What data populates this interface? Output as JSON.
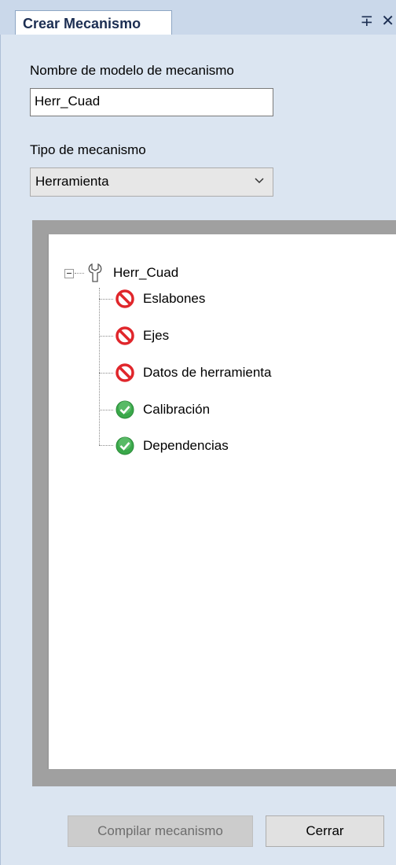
{
  "panel": {
    "tab_title": "Crear Mecanismo",
    "pin_glyph": "∓",
    "close_glyph": "✕"
  },
  "form": {
    "model_name_label": "Nombre de modelo de mecanismo",
    "model_name_value": "Herr_Cuad",
    "type_label": "Tipo de mecanismo",
    "type_value": "Herramienta"
  },
  "tree": {
    "root": {
      "label": "Herr_Cuad",
      "icon": "wrench-icon",
      "expanded": true
    },
    "children": [
      {
        "label": "Eslabones",
        "status": "error",
        "icon": "prohibited-icon"
      },
      {
        "label": "Ejes",
        "status": "error",
        "icon": "prohibited-icon"
      },
      {
        "label": "Datos de herramienta",
        "status": "error",
        "icon": "prohibited-icon"
      },
      {
        "label": "Calibración",
        "status": "ok",
        "icon": "check-icon"
      },
      {
        "label": "Dependencias",
        "status": "ok",
        "icon": "check-icon"
      }
    ]
  },
  "buttons": {
    "compile_label": "Compilar mecanismo",
    "compile_enabled": false,
    "close_label": "Cerrar"
  },
  "colors": {
    "error_red": "#e0262b",
    "ok_green": "#3aa84a",
    "panel_bg": "#dbe5f1"
  }
}
